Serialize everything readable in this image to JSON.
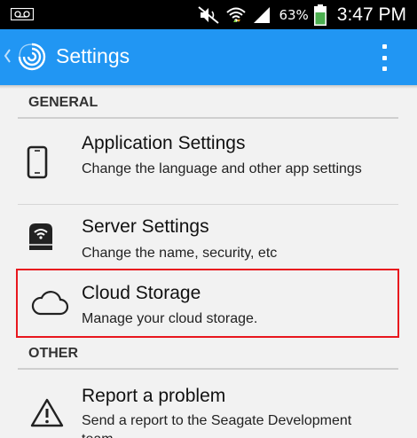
{
  "status_bar": {
    "battery_percent": "63%",
    "time": "3:47 PM",
    "icons": [
      "voicemail-icon",
      "mute-icon",
      "wifi-icon",
      "signal-icon",
      "battery-icon"
    ],
    "colors": {
      "background": "#000000",
      "battery": "#4caf50"
    }
  },
  "action_bar": {
    "title": "Settings",
    "icons": [
      "back-chevron-icon",
      "seagate-logo-icon",
      "overflow-menu-icon"
    ],
    "color": "#2196f3"
  },
  "sections": {
    "general": "GENERAL",
    "other": "OTHER"
  },
  "items": {
    "application_settings": {
      "title": "Application Settings",
      "subtitle": "Change the language and other app settings",
      "icon": "phone-icon"
    },
    "server_settings": {
      "title": "Server Settings",
      "subtitle": "Change the name, security, etc",
      "icon": "server-drive-icon"
    },
    "cloud_storage": {
      "title": "Cloud Storage",
      "subtitle": "Manage your cloud storage.",
      "icon": "cloud-icon"
    },
    "report_problem": {
      "title": "Report a problem",
      "subtitle": "Send a report to the Seagate Development team",
      "icon": "warning-icon"
    }
  },
  "highlight_color": "#e8171e"
}
